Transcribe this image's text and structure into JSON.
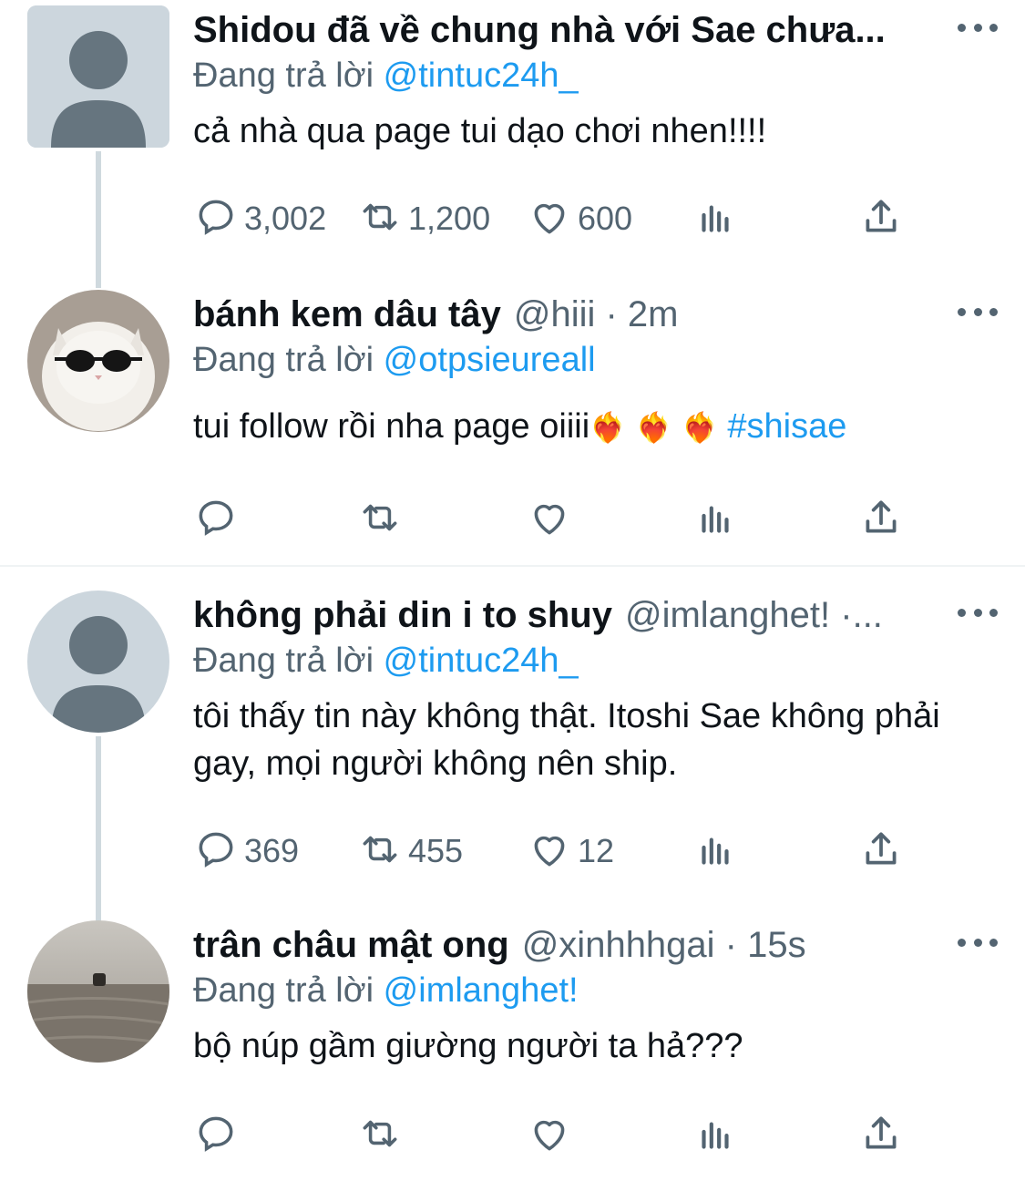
{
  "tweets": [
    {
      "display_name": "Shidou đã về chung nhà với Sae chưa...",
      "handle": "",
      "reply_prefix": "Đang trả lời",
      "reply_to": "@tintuc24h_",
      "text": "cả nhà qua page tui dạo chơi nhen!!!!",
      "counts": {
        "reply": "3,002",
        "retweet": "1,200",
        "like": "600"
      },
      "avatar": "default-avatar"
    },
    {
      "display_name": "bánh kem dâu tây",
      "handle": "@hiii · 2m",
      "reply_prefix": "Đang trả lời",
      "reply_to": "@otpsieureall",
      "text": "tui follow rồi nha page oiiii",
      "emojis": [
        "❤️‍🔥",
        "❤️‍🔥",
        "❤️‍🔥"
      ],
      "hashtag": "#shisae",
      "counts": {
        "reply": "",
        "retweet": "",
        "like": ""
      },
      "avatar": "cat-sunglasses-avatar"
    },
    {
      "display_name": "không phải din i to shuy",
      "handle": "@imlanghet! ·...",
      "reply_prefix": "Đang trả lời",
      "reply_to": "@tintuc24h_",
      "text": "tôi thấy tin này không thật. Itoshi Sae không phải gay, mọi người không nên ship.",
      "counts": {
        "reply": "369",
        "retweet": "455",
        "like": "12"
      },
      "avatar": "default-avatar"
    },
    {
      "display_name": "trân châu mật ong",
      "handle": "@xinhhhgai · 15s",
      "reply_prefix": "Đang trả lời",
      "reply_to": "@imlanghet!",
      "text": "bộ núp gầm giường người ta hả???",
      "counts": {
        "reply": "",
        "retweet": "",
        "like": ""
      },
      "avatar": "photo-avatar"
    }
  ],
  "colors": {
    "link": "#1d9bf0",
    "secondary_text": "#536471",
    "thread_line": "#cfd9de"
  },
  "icons": [
    "reply-icon",
    "retweet-icon",
    "like-icon",
    "views-icon",
    "share-icon",
    "more-icon"
  ]
}
